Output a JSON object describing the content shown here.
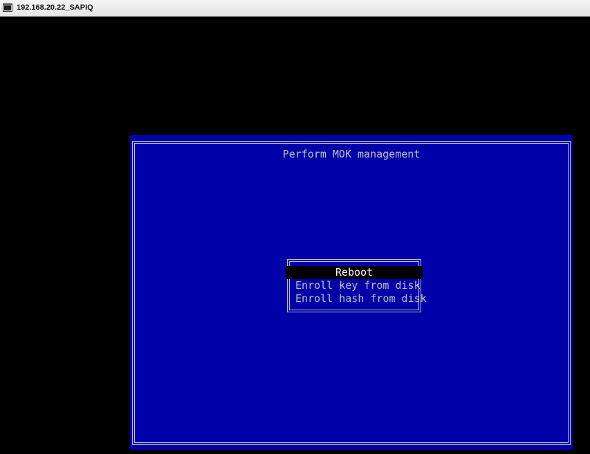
{
  "window": {
    "title": "192.168.20.22_SAPIQ",
    "icon": "console-window-icon"
  },
  "colors": {
    "screen_background": "#0000a8",
    "text": "#c0c0c0",
    "selected_background": "#000000",
    "selected_text": "#ffffff",
    "frame": "#bfbfbf"
  },
  "mok": {
    "title": "Perform MOK management",
    "menu": {
      "selected_index": 0,
      "items": [
        "Reboot",
        "Enroll key from disk",
        "Enroll hash from disk"
      ]
    }
  }
}
